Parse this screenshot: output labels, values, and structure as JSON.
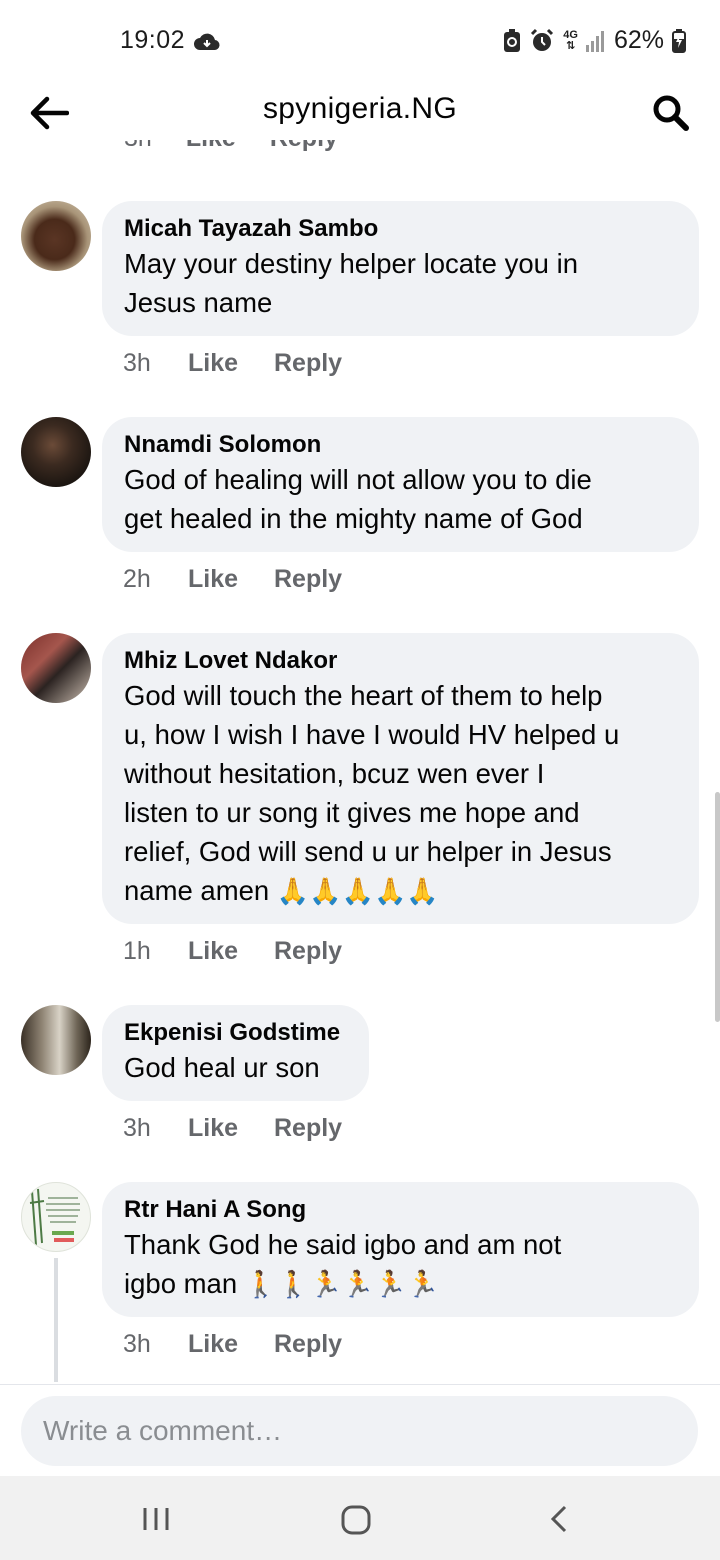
{
  "status_bar": {
    "time": "19:02",
    "network": "4G",
    "battery": "62%"
  },
  "header": {
    "title": "spynigeria.NG"
  },
  "colors": {
    "bubble": "#f0f2f5",
    "meta_text": "#65676b",
    "text": "#050505"
  },
  "comments": [
    {
      "author": "Micah Tayazah Sambo",
      "lines": [
        "May your destiny helper locate you in",
        "Jesus name"
      ],
      "time": "3h",
      "like": "Like",
      "reply": "Reply"
    },
    {
      "author": "Nnamdi Solomon",
      "lines": [
        "God of healing will not allow you to die",
        "get healed in the mighty name of God"
      ],
      "time": "2h",
      "like": "Like",
      "reply": "Reply"
    },
    {
      "author": "Mhiz Lovet Ndakor",
      "lines": [
        "God will touch the heart of them to help",
        "u, how I wish I have I would HV helped u",
        "without hesitation, bcuz wen ever I",
        "listen to ur song it gives me hope and",
        "relief, God will send u ur helper in Jesus",
        "name amen"
      ],
      "emoji": "🙏🙏🙏🙏🙏",
      "time": "1h",
      "like": "Like",
      "reply": "Reply"
    },
    {
      "author": "Ekpenisi Godstime",
      "lines": [
        "God heal ur son"
      ],
      "time": "3h",
      "like": "Like",
      "reply": "Reply"
    },
    {
      "author": "Rtr Hani A Song",
      "lines": [
        "Thank God he said igbo and am not",
        "igbo man"
      ],
      "emoji": "🚶🚶🏃🏃🏃🏃",
      "time": "3h",
      "like": "Like",
      "reply": "Reply"
    }
  ],
  "composer": {
    "placeholder": "Write a comment…"
  }
}
